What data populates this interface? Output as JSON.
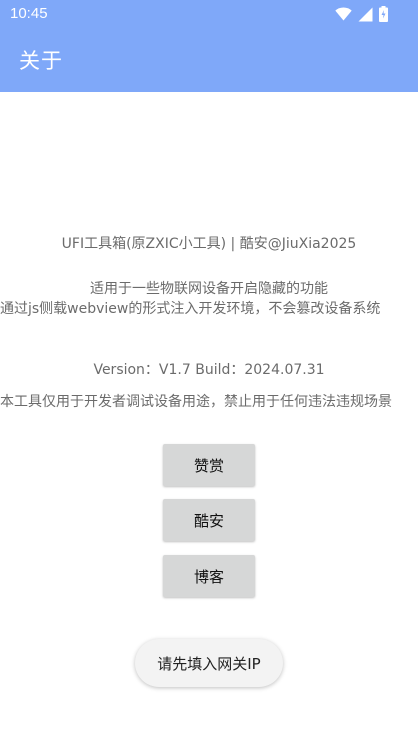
{
  "status_bar": {
    "time": "10:45",
    "icons": [
      "wifi-icon",
      "signal-icon",
      "battery-icon"
    ]
  },
  "app_bar": {
    "title": "关于",
    "color": "#7fa8f9"
  },
  "about": {
    "credit": "UFI工具箱(原ZXIC小工具)  |  酷安@JiuXia2025",
    "desc_line1": "适用于一些物联网设备开启隐藏的功能",
    "desc_line2": "通过js侧载webview的形式注入开发环境，不会篡改设备系统",
    "version": "Version：V1.7  Build：2024.07.31",
    "disclaimer": "本工具仅用于开发者调试设备用途，禁止用于任何违法违规场景"
  },
  "buttons": {
    "reward": "赞赏",
    "coolapk": "酷安",
    "blog": "博客"
  },
  "toast": {
    "message": "请先填入网关IP"
  }
}
